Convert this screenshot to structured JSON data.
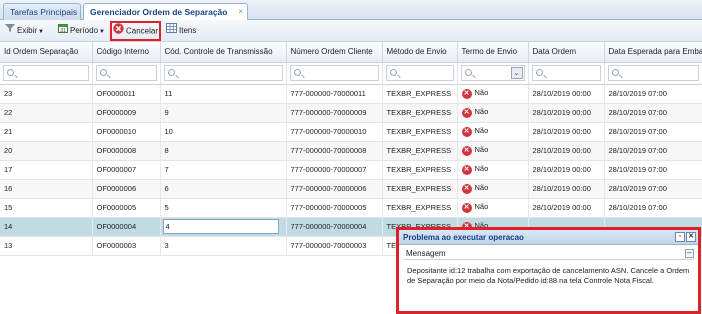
{
  "tabs": [
    {
      "label": "Tarefas Principais"
    },
    {
      "label": "Gerenciador Ordem de Separação",
      "close": "×"
    }
  ],
  "toolbar": {
    "exibir": "Exibir",
    "periodo": "Período",
    "cancelar": "Cancelar",
    "itens": "Itens"
  },
  "grid": {
    "columns": [
      "Id Ordem Separação",
      "Código Interno",
      "Cód. Controle de Transmissão",
      "Número Ordem Cliente",
      "Método de Envio",
      "Termo de Envio",
      "Data Ordem",
      "Data Esperada para Emba"
    ],
    "rows": [
      [
        "23",
        "OF0000011",
        "11",
        "777-000000-70000011",
        "TEXBR_EXPRESS",
        "Não",
        "28/10/2019 00:00",
        "28/10/2019 07:00"
      ],
      [
        "22",
        "OF0000009",
        "9",
        "777-000000-70000009",
        "TEXBR_EXPRESS",
        "Não",
        "28/10/2019 00:00",
        "28/10/2019 07:00"
      ],
      [
        "21",
        "OF0000010",
        "10",
        "777-000000-70000010",
        "TEXBR_EXPRESS",
        "Não",
        "28/10/2019 00:00",
        "28/10/2019 07:00"
      ],
      [
        "20",
        "OF0000008",
        "8",
        "777-000000-70000008",
        "TEXBR_EXPRESS",
        "Não",
        "28/10/2019 00:00",
        "28/10/2019 07:00"
      ],
      [
        "17",
        "OF0000007",
        "7",
        "777-000000-70000007",
        "TEXBR_EXPRESS",
        "Não",
        "28/10/2019 00:00",
        "28/10/2019 07:00"
      ],
      [
        "16",
        "OF0000006",
        "6",
        "777-000000-70000006",
        "TEXBR_EXPRESS",
        "Não",
        "28/10/2019 00:00",
        "28/10/2019 07:00"
      ],
      [
        "15",
        "OF0000005",
        "5",
        "777-000000-70000005",
        "TEXBR_EXPRESS",
        "Não",
        "28/10/2019 00:00",
        "28/10/2019 07:00"
      ],
      [
        "14",
        "OF0000004",
        "4",
        "777-000000-70000004",
        "TEXBR_EXPRESS",
        "Não",
        "",
        ""
      ],
      [
        "13",
        "OF0000003",
        "3",
        "777-000000-70000003",
        "TEXBR_EXPRESS",
        "",
        "",
        ""
      ]
    ]
  },
  "popup": {
    "title": "Problema ao executar operacao",
    "section": "Mensagem",
    "message": "Depositante id:12 trabalha com exportação de cancelamento ASN. Cancele a Ordem de Separação por meio da Nota/Pedido id:88 na tela Controle Nota Fiscal."
  },
  "colors": {
    "highlight": "#e0202a",
    "selected_row": "#c2dbe3",
    "error_icon": "#d4343b"
  }
}
